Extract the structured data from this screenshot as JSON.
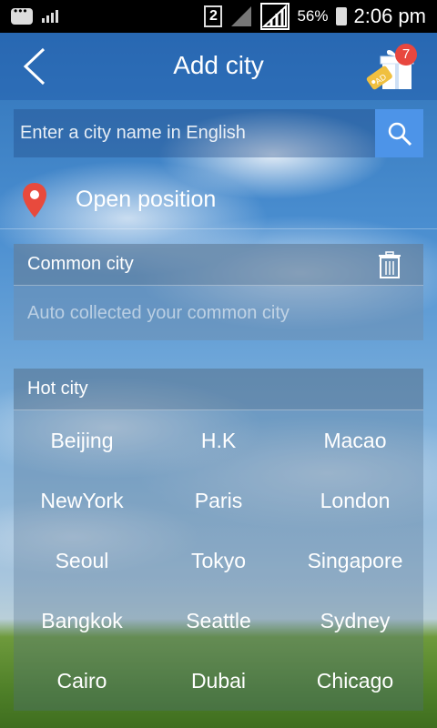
{
  "status_bar": {
    "sim_slot": "2",
    "battery": "56%",
    "time": "2:06 pm"
  },
  "header": {
    "title": "Add city",
    "badge_count": "7",
    "gift_tag": "AD"
  },
  "search": {
    "placeholder": "Enter a city name in English"
  },
  "open_position": {
    "label": "Open position"
  },
  "common_city": {
    "title": "Common city",
    "hint": "Auto collected your common city"
  },
  "hot_city": {
    "title": "Hot city",
    "cities": [
      "Beijing",
      "H.K",
      "Macao",
      "NewYork",
      "Paris",
      "London",
      "Seoul",
      "Tokyo",
      "Singapore",
      "Bangkok",
      "Seattle",
      "Sydney",
      "Cairo",
      "Dubai",
      "Chicago"
    ]
  },
  "colors": {
    "accent": "#4d94e8",
    "badge": "#e8473f",
    "pin": "#e84a3d"
  }
}
